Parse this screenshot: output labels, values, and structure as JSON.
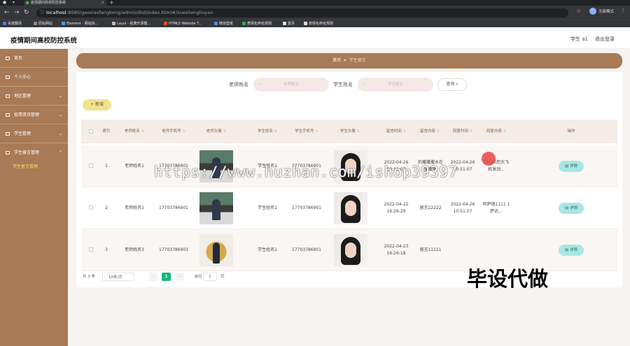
{
  "browser": {
    "tab_title": "疫情期间高校防控系统",
    "address_host": "localhost",
    "address_path": ":8080/gaoxiaofangkong/admin/dist/index.html#/xueshengliuyan",
    "profile_label": "无痕模式",
    "bookmarks": [
      "百度翻译",
      "原始网站",
      "Element - 网站快...",
      "Layui - 经典开源模...",
      "HTML5 Website T...",
      "微信壁纸",
      "表情包命名规则",
      "首页",
      "表情包命名规则"
    ]
  },
  "header": {
    "title": "疫情期间高校防控系统",
    "user": "学生 a1",
    "logout": "退出登录"
  },
  "sidebar": {
    "items": [
      {
        "label": "首页"
      },
      {
        "label": "个人中心"
      },
      {
        "label": "地区管理"
      },
      {
        "label": "疫情资讯管理"
      },
      {
        "label": "学生管理"
      },
      {
        "label": "学生留言管理"
      }
    ],
    "sub_active": "学生留言管理"
  },
  "breadcrumb": {
    "home": "首页",
    "current": "学生留言"
  },
  "search": {
    "teacher_label": "老师姓名",
    "teacher_placeholder": "老师姓名",
    "student_label": "学生姓名",
    "student_placeholder": "学生姓名",
    "button": "查询"
  },
  "add_button": "+ 新增",
  "table": {
    "headers": [
      "索引",
      "老师姓名",
      "老师手机号",
      "老师头像",
      "学生姓名",
      "学生手机号",
      "学生头像",
      "留言时间",
      "留言内容",
      "回复时间",
      "回复内容",
      "操作"
    ],
    "rows": [
      {
        "index": "1",
        "teacher_name": "老师姓名1",
        "teacher_phone": "17703786901",
        "student_name": "学生姓名1",
        "student_phone": "17703786901",
        "msg_time": "2022-04-26 10:51:07",
        "msg_content": "的撒撒撒水在撒撒撒",
        "reply_time": "2022-04-26 10:51:07",
        "reply_content": "我的验您大飞机发动...",
        "action": "详情"
      },
      {
        "index": "2",
        "teacher_name": "老师姓名1",
        "teacher_phone": "17703786901",
        "student_name": "学生姓名1",
        "student_phone": "17703786901",
        "msg_time": "2022-04-22 16:26:29",
        "msg_content": "留言22222",
        "reply_time": "2022-04-26 10:51:07",
        "reply_content": "阿萨德1111 1萨达...",
        "action": "详情"
      },
      {
        "index": "3",
        "teacher_name": "老师姓名3",
        "teacher_phone": "17703786903",
        "student_name": "学生姓名1",
        "student_phone": "17703786901",
        "msg_time": "2022-04-23 16:26:18",
        "msg_content": "留言11111",
        "reply_time": "",
        "reply_content": "",
        "action": "详情"
      }
    ]
  },
  "pager": {
    "total": "共 3 条",
    "page_size": "10条/页",
    "current": "1",
    "goto_label": "前往",
    "goto_value": "1",
    "page_unit": "页"
  },
  "overlay": {
    "watermark": "https://www.huzhan.com/ishop39397",
    "stamp": "毕设代做"
  },
  "colors": {
    "sidebar": "#a87a56",
    "accent_green": "#19b884",
    "detail_button": "#a8e6e4",
    "add_button": "#f1e28f"
  }
}
